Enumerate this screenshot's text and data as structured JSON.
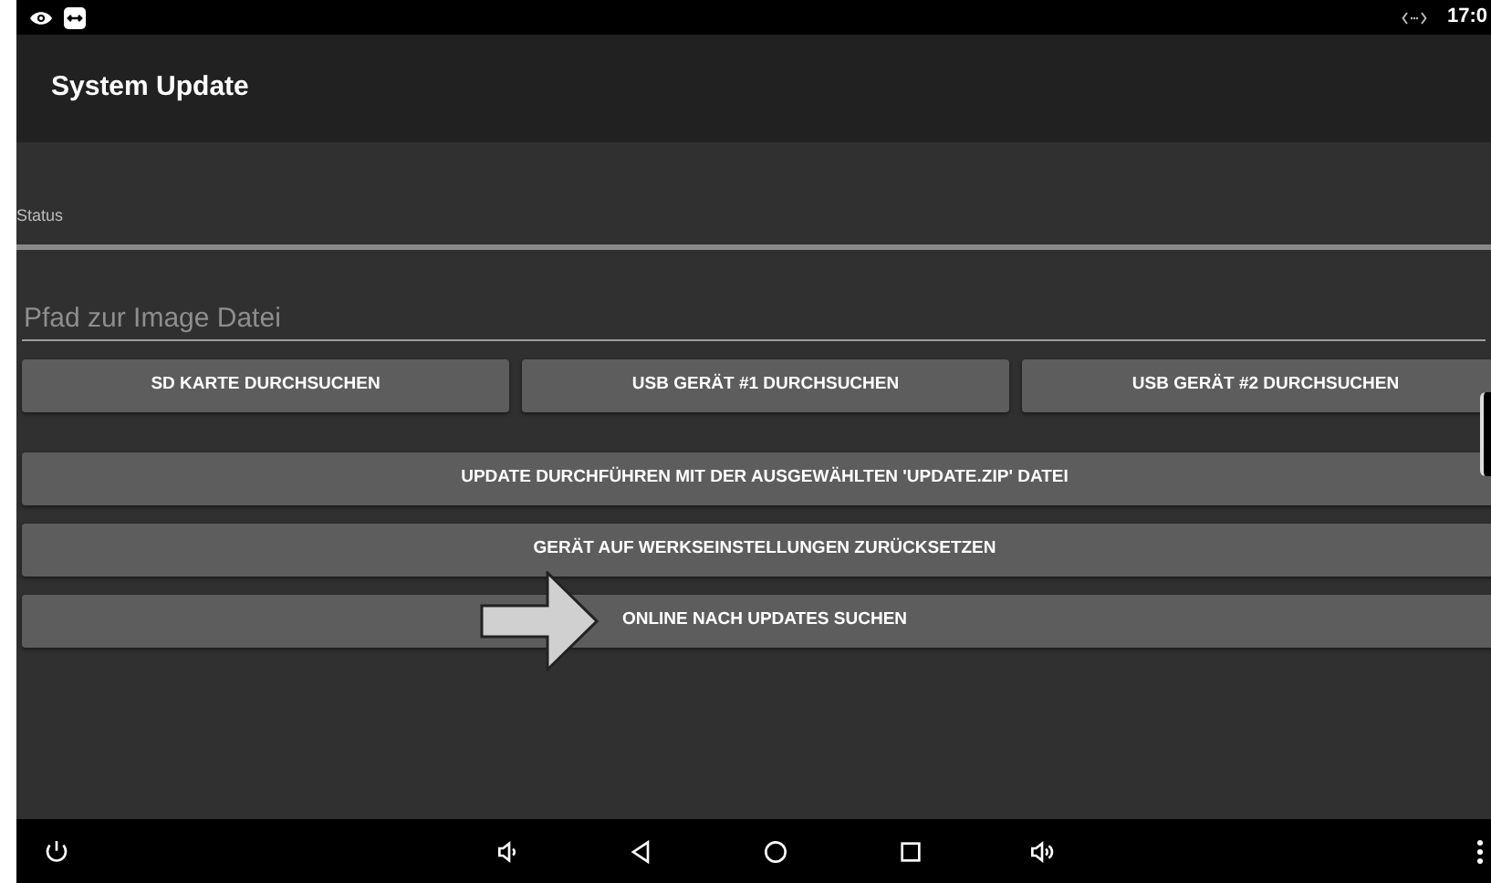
{
  "status_bar": {
    "time": "17:0"
  },
  "app_bar": {
    "title": "System Update"
  },
  "status": {
    "label": "Status"
  },
  "path_field": {
    "placeholder": "Pfad zur Image Datei"
  },
  "browse_buttons": [
    "SD KARTE DURCHSUCHEN",
    "USB GERÄT #1 DURCHSUCHEN",
    "USB GERÄT #2 DURCHSUCHEN"
  ],
  "action_buttons": [
    "UPDATE DURCHFÜHREN MIT DER AUSGEWÄHLTEN 'UPDATE.ZIP' DATEI",
    "GERÄT AUF WERKSEINSTELLUNGEN ZURÜCKSETZEN",
    "ONLINE NACH UPDATES SUCHEN"
  ]
}
